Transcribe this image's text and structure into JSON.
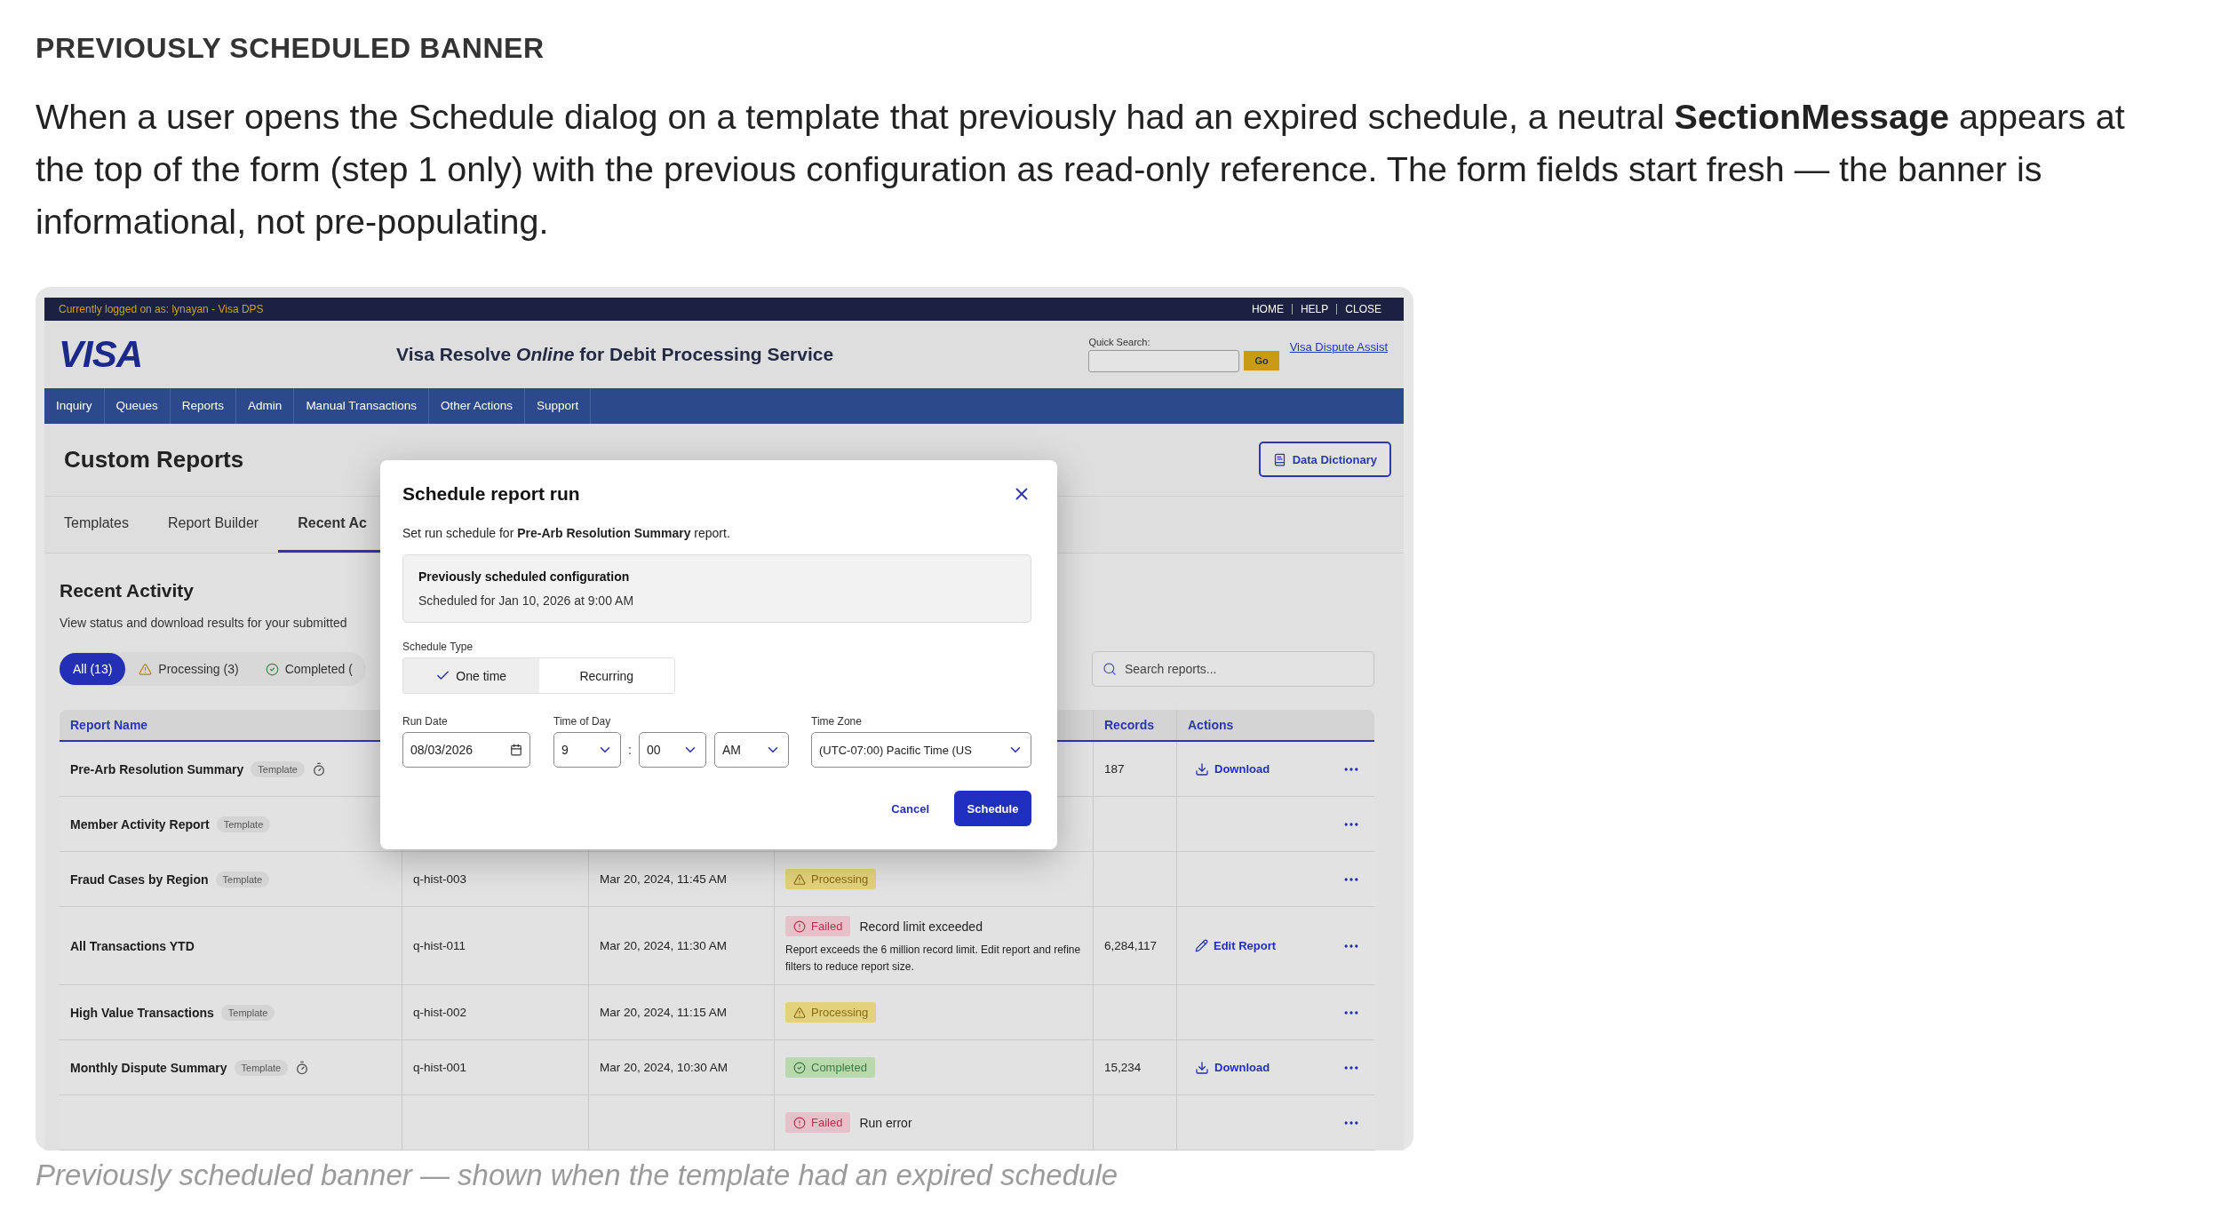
{
  "doc": {
    "heading": "PREVIOUSLY SCHEDULED BANNER",
    "paragraph": "When a user opens the Schedule dialog on a template that previously had an expired schedule, a neutral **SectionMessage** appears at the top of the form (step 1 only) with the previous configuration as read-only reference. The form fields start fresh — the banner is informational, not pre-populating.",
    "caption": "Previously scheduled banner — shown when the template had an expired schedule"
  },
  "screenshot": {
    "top_bar": {
      "login": "Currently logged on as: lynayan - Visa DPS",
      "links": [
        "HOME",
        "HELP",
        "CLOSE"
      ]
    },
    "header": {
      "logo": "VISA",
      "title": "Visa Resolve *Online* for Debit Processing Service",
      "quick_search": {
        "label": "Quick Search:",
        "button": "Go"
      },
      "link": "Visa Dispute Assist"
    },
    "nav": [
      "Inquiry",
      "Queues",
      "Reports",
      "Admin",
      "Manual Transactions",
      "Other Actions",
      "Support"
    ],
    "page": {
      "title": "Custom Reports",
      "action": "Data Dictionary",
      "tabs": [
        {
          "label": "Templates",
          "selected": false
        },
        {
          "label": "Report Builder",
          "selected": false
        },
        {
          "label": "Recent Ac",
          "selected": true
        }
      ]
    },
    "section": {
      "title": "Recent Activity",
      "subtitle": "View status and download results for your submitted",
      "filters": [
        {
          "label": "All (13)",
          "kind": "all",
          "selected": true
        },
        {
          "label": "Processing (3)",
          "kind": "processing",
          "selected": false
        },
        {
          "label": "Completed (",
          "kind": "completed",
          "selected": false
        }
      ],
      "search": {
        "placeholder": "Search reports..."
      }
    },
    "table": {
      "header": {
        "report_name": "Report Name",
        "records": "Records",
        "actions": "Actions"
      },
      "rows": [
        {
          "name": "Pre-Arb Resolution Summary",
          "tag": "Template",
          "scheduled": true,
          "records": "187",
          "action": {
            "kind": "download",
            "label": "Download"
          }
        },
        {
          "name": "Member Activity Report",
          "tag": "Template",
          "scheduled": false
        },
        {
          "name": "Fraud Cases by Region",
          "tag": "Template",
          "scheduled": false,
          "query": "q-hist-003",
          "submitted": "Mar 20, 2024, 11:45 AM",
          "status": {
            "kind": "processing",
            "label": "Processing"
          }
        },
        {
          "name": "All Transactions YTD",
          "scheduled": false,
          "query": "q-hist-011",
          "submitted": "Mar 20, 2024, 11:30 AM",
          "status": {
            "kind": "failed",
            "label": "Failed"
          },
          "status_note": "Record limit exceeded",
          "status_detail": "Report exceeds the 6 million record limit. Edit report and refine filters to reduce report size.",
          "records": "6,284,117",
          "action": {
            "kind": "edit",
            "label": "Edit Report"
          }
        },
        {
          "name": "High Value Transactions",
          "tag": "Template",
          "scheduled": false,
          "query": "q-hist-002",
          "submitted": "Mar 20, 2024, 11:15 AM",
          "status": {
            "kind": "processing",
            "label": "Processing"
          }
        },
        {
          "name": "Monthly Dispute Summary",
          "tag": "Template",
          "scheduled": true,
          "query": "q-hist-001",
          "submitted": "Mar 20, 2024, 10:30 AM",
          "status": {
            "kind": "completed",
            "label": "Completed"
          },
          "records": "15,234",
          "action": {
            "kind": "download",
            "label": "Download"
          }
        },
        {
          "scheduled": false,
          "status": {
            "kind": "failed",
            "label": "Failed"
          },
          "status_note": "Run error"
        }
      ]
    },
    "modal": {
      "title": "Schedule report run",
      "subtitle": "Set run schedule for **Pre-Arb Resolution Summary** report.",
      "banner": {
        "title": "Previously scheduled configuration",
        "text": "Scheduled for Jan 10, 2026 at 9:00 AM"
      },
      "schedule_type": {
        "label": "Schedule Type",
        "options": [
          {
            "label": "One time",
            "selected": true
          },
          {
            "label": "Recurring",
            "selected": false
          }
        ]
      },
      "run_date": {
        "label": "Run Date",
        "value": "08/03/2026"
      },
      "time": {
        "label": "Time of Day",
        "hour": "9",
        "separator": ":",
        "minute": "00",
        "period": "AM"
      },
      "time_zone": {
        "label": "Time Zone",
        "value": "(UTC-07:00) Pacific Time (US"
      },
      "buttons": {
        "cancel": "Cancel",
        "confirm": "Schedule"
      }
    }
  }
}
